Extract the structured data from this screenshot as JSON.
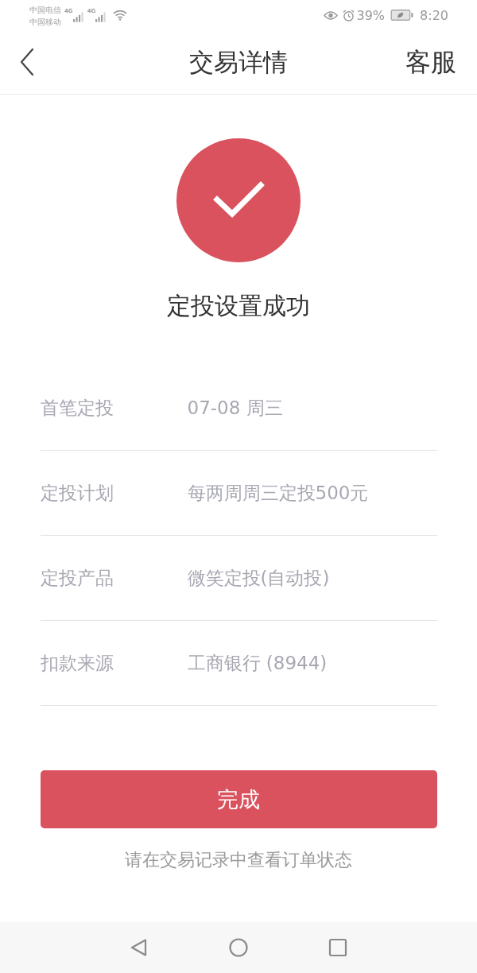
{
  "status_bar": {
    "carriers": [
      "中国电信",
      "中国移动"
    ],
    "signals": [
      {
        "network": "4G"
      },
      {
        "network": "4G"
      }
    ],
    "battery": "39%",
    "time": "8:20"
  },
  "nav_bar": {
    "title": "交易详情",
    "action": "客服"
  },
  "result": {
    "succeeded": true,
    "message": "定投设置成功"
  },
  "details": [
    {
      "label": "首笔定投",
      "value": "07-08 周三"
    },
    {
      "label": "定投计划",
      "value": "每两周周三定投500元"
    },
    {
      "label": "定投产品",
      "value": "微笑定投(自动投)"
    },
    {
      "label": "扣款来源",
      "value": "工商银行 (8944)"
    }
  ],
  "primary_button": {
    "label": "完成"
  },
  "hint": "请在交易记录中查看订单状态"
}
